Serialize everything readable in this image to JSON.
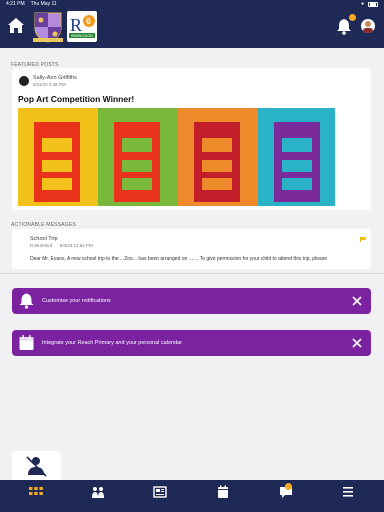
{
  "status_bar": {
    "time": "4:21 PM",
    "date": "Thu May 11"
  },
  "colors": {
    "navy": "#1e2a55",
    "purple": "#7b22a1",
    "orange": "#f6a821"
  },
  "header": {
    "logo_text": "R6",
    "logo_subtext": "WIMBLEDON"
  },
  "featured": {
    "label": "FEATURED POSTS",
    "post": {
      "author": "Sally-Ann Griffiths",
      "date": "5/11/23 3:48 PM",
      "title": "Pop Art Competition Winner!",
      "image": "pop-art-phone-box-prints"
    }
  },
  "actionable": {
    "label": "ACTIONABLE MESSAGES",
    "message": {
      "title": "School Trip",
      "sender": "D Mumford",
      "date": "5/4/23 12:54 PM",
      "body": "Dear Mr. Evans, A new school trip to the ...Zoo... has been arranged on ....... To give permission for your child to attend this trip, please"
    }
  },
  "promos": [
    {
      "text": "Customise your notifications",
      "icon": "bell-icon"
    },
    {
      "text": "Integrate your Reach Primary and your personal calendar",
      "icon": "calendar-icon"
    }
  ],
  "tabs": [
    "home-grid-icon",
    "people-icon",
    "news-icon",
    "calendar-icon",
    "chat-icon",
    "menu-icon"
  ]
}
